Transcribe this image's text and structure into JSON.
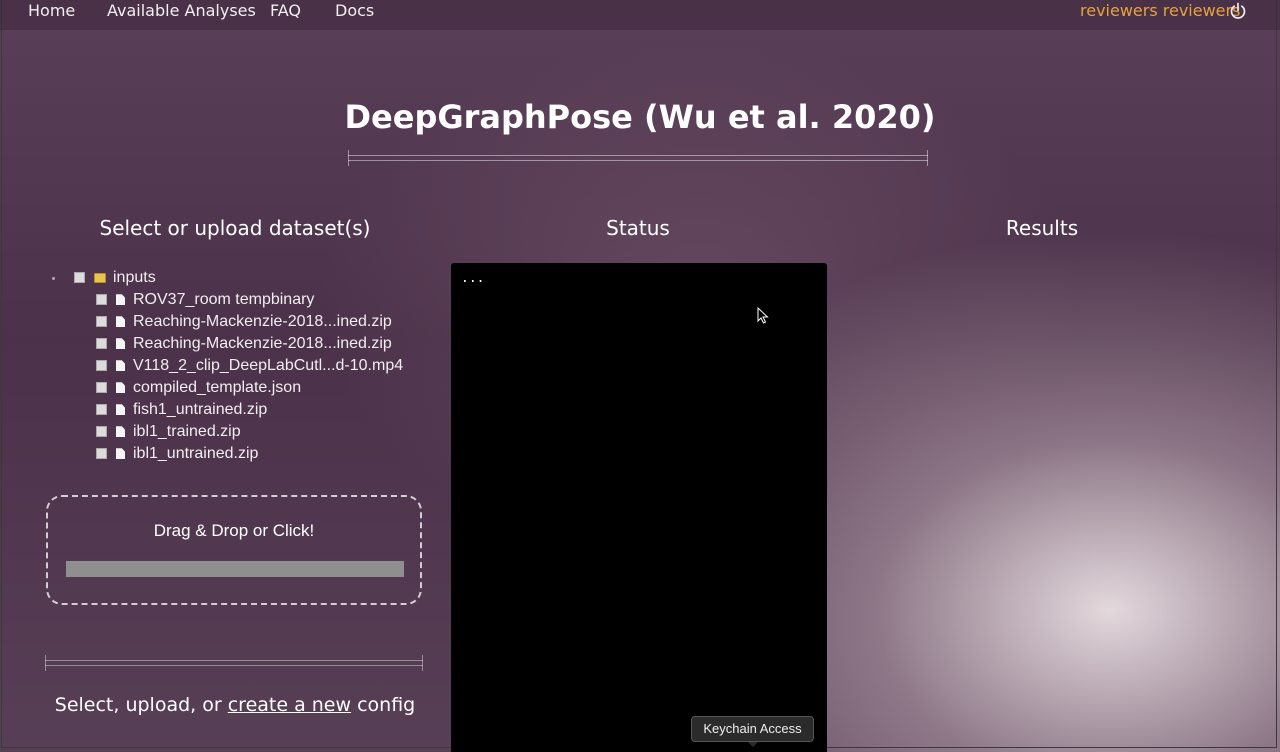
{
  "nav": {
    "links": [
      "Home",
      "Available Analyses",
      "FAQ",
      "Docs"
    ],
    "user": "reviewers reviewers",
    "power_icon": "power-icon"
  },
  "page": {
    "title": "DeepGraphPose (Wu et al. 2020)"
  },
  "columns": {
    "left": "Select or upload dataset(s)",
    "middle": "Status",
    "right": "Results"
  },
  "tree": {
    "root": "inputs",
    "root_icon": "folder-icon",
    "files": [
      "ROV37_room tempbinary",
      "Reaching-Mackenzie-2018...ined.zip",
      "Reaching-Mackenzie-2018...ined.zip",
      "V118_2_clip_DeepLabCutl...d-10.mp4",
      "compiled_template.json",
      "fish1_untrained.zip",
      "ibl1_trained.zip",
      "ibl1_untrained.zip"
    ],
    "file_icon": "file-icon"
  },
  "upload": {
    "label": "Drag & Drop or Click!"
  },
  "config": {
    "prefix": "Select, upload, or ",
    "link": "create a new",
    "suffix": " config"
  },
  "status": {
    "text": "..."
  },
  "tooltip": {
    "text": "Keychain Access"
  },
  "colors": {
    "user_link": "#e6a33c",
    "status_bg": "#000000"
  }
}
